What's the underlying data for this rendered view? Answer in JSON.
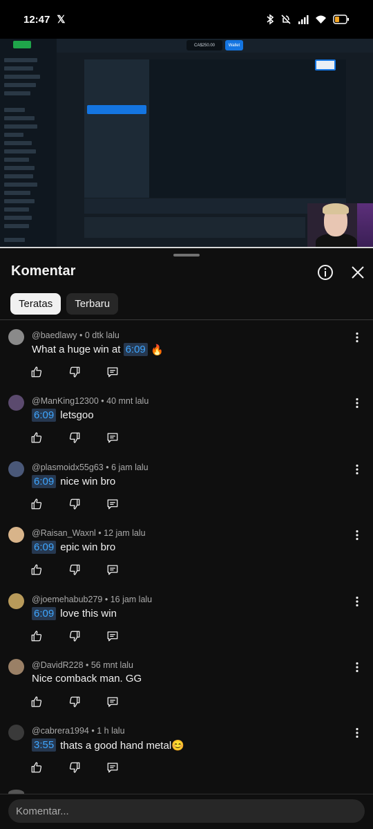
{
  "status_bar": {
    "time": "12:47",
    "app_icon": "x-icon"
  },
  "video": {
    "balance": "CA$250.00",
    "wallet": "Wallet",
    "player": "Webcam overlay"
  },
  "sheet": {
    "title": "Komentar",
    "tabs": [
      {
        "label": "Teratas",
        "selected": true
      },
      {
        "label": "Terbaru",
        "selected": false
      }
    ]
  },
  "comments": [
    {
      "author": "@baedlawy",
      "time": "0 dtk lalu",
      "timestamp": "6:09",
      "before": "What a huge win at ",
      "after": " 🔥"
    },
    {
      "author": "@ManKing12300",
      "time": "40 mnt lalu",
      "timestamp": "6:09",
      "before": "",
      "after": "letsgoo"
    },
    {
      "author": "@plasmoidx55g63",
      "time": "6 jam lalu",
      "timestamp": "6:09",
      "before": "",
      "after": "nice win bro"
    },
    {
      "author": "@Raisan_Waxnl",
      "time": "12 jam lalu",
      "timestamp": "6:09",
      "before": "",
      "after": "epic win bro"
    },
    {
      "author": "@joemehabub279",
      "time": "16 jam lalu",
      "timestamp": "6:09",
      "before": "",
      "after": "love this win"
    },
    {
      "author": "@DavidR228",
      "time": "56 mnt lalu",
      "timestamp": "",
      "before": "Nice comback man. GG",
      "after": ""
    },
    {
      "author": "@cabrera1994",
      "time": "1 h lalu",
      "timestamp": "3:55",
      "before": "",
      "after": "thats a good hand metal😊"
    }
  ],
  "composer": {
    "placeholder": "Komentar..."
  },
  "colors": {
    "background": "#0f0f0f",
    "timestamp_link": "#3ea6ff",
    "timestamp_bg": "#263850"
  }
}
